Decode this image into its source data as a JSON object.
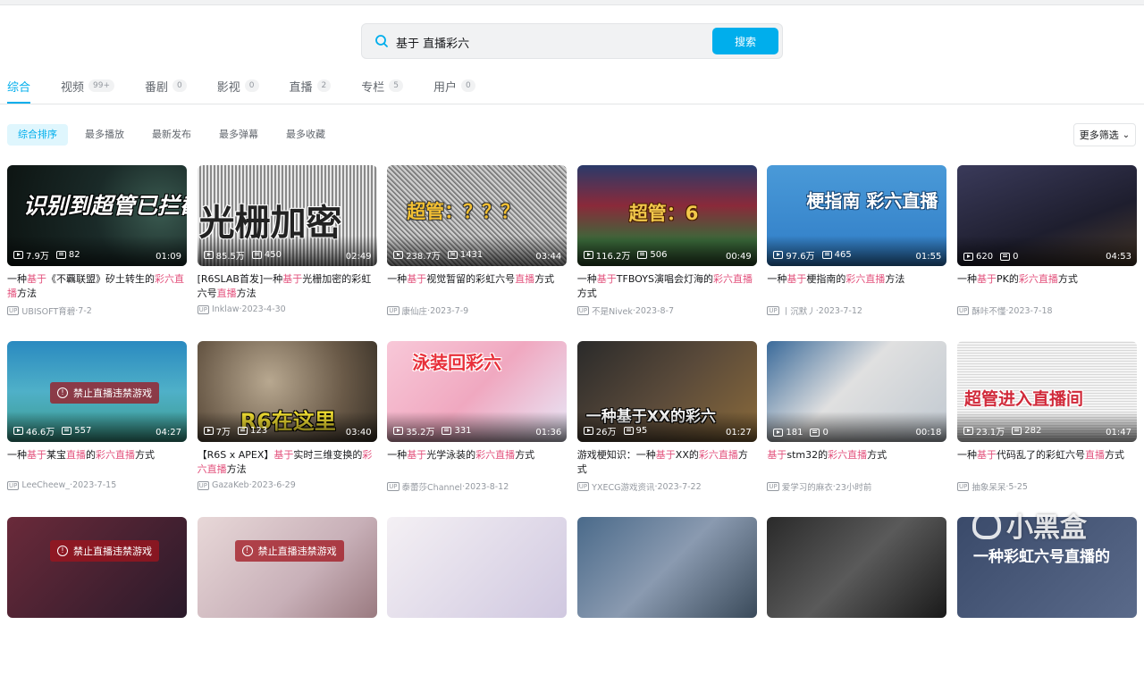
{
  "search": {
    "query": "基于 直播彩六",
    "button": "搜索"
  },
  "tabs": [
    {
      "label": "综合",
      "count": ""
    },
    {
      "label": "视频",
      "count": "99+"
    },
    {
      "label": "番剧",
      "count": "0"
    },
    {
      "label": "影视",
      "count": "0"
    },
    {
      "label": "直播",
      "count": "2"
    },
    {
      "label": "专栏",
      "count": "5"
    },
    {
      "label": "用户",
      "count": "0"
    }
  ],
  "sort": [
    "综合排序",
    "最多播放",
    "最新发布",
    "最多弹幕",
    "最多收藏"
  ],
  "filter_label": "更多筛选",
  "up_tag": "UP",
  "videos": [
    {
      "overlay": "识别到超管已拦截",
      "views": "7.9万",
      "danmaku": "82",
      "duration": "01:09",
      "title_parts": [
        "一种",
        "基于",
        "《不覊联盟》矽土转生的",
        "彩六直播",
        "方法"
      ],
      "author": "UBISOFT育碧",
      "date": "7-2"
    },
    {
      "overlay": "光栅加密",
      "views": "85.5万",
      "danmaku": "450",
      "duration": "02:49",
      "title_parts": [
        "[R6SLAB首发]一种",
        "基于",
        "光栅加密的彩虹六号",
        "直播",
        "方法"
      ],
      "author": "Inklaw",
      "date": "2023-4-30"
    },
    {
      "overlay": "超管：？？？",
      "views": "238.7万",
      "danmaku": "1431",
      "duration": "03:44",
      "title_parts": [
        "一种",
        "基于",
        "视觉暂留的彩虹六号",
        "直播",
        "方式"
      ],
      "author": "康仙庄",
      "date": "2023-7-9"
    },
    {
      "overlay": "超管：6",
      "views": "116.2万",
      "danmaku": "506",
      "duration": "00:49",
      "title_parts": [
        "一种",
        "基于",
        "TFBOYS演唱会灯海的",
        "彩六直播",
        "方式"
      ],
      "author": "不是Nivek",
      "date": "2023-8-7"
    },
    {
      "overlay": "梗指南 彩六直播",
      "views": "97.6万",
      "danmaku": "465",
      "duration": "01:55",
      "title_parts": [
        "一种",
        "基于",
        "梗指南的",
        "彩六直播",
        "方法"
      ],
      "author": "丨沉默丿",
      "date": "2023-7-12"
    },
    {
      "overlay": "",
      "views": "620",
      "danmaku": "0",
      "duration": "04:53",
      "title_parts": [
        "一种",
        "基于",
        "PK的",
        "彩六直播",
        "方式"
      ],
      "author": "酥咔不懂",
      "date": "2023-7-18"
    },
    {
      "overlay": "禁止直播违禁游戏",
      "views": "46.6万",
      "danmaku": "557",
      "duration": "04:27",
      "title_parts": [
        "一种",
        "基于",
        "某宝",
        "直播",
        "的",
        "彩六直播",
        "方式"
      ],
      "author": "LeeCheew_",
      "date": "2023-7-15"
    },
    {
      "overlay": "R6在这里",
      "views": "7万",
      "danmaku": "123",
      "duration": "03:40",
      "title_parts": [
        "【R6S x APEX】",
        "基于",
        "实时三维变换的",
        "彩六直播",
        "方法"
      ],
      "author": "GazaKeb",
      "date": "2023-6-29"
    },
    {
      "overlay": "泳装回彩六",
      "views": "35.2万",
      "danmaku": "331",
      "duration": "01:36",
      "title_parts": [
        "一种",
        "基于",
        "光学泳装的",
        "彩六直播",
        "方式"
      ],
      "author": "泰蕾莎Channel",
      "date": "2023-8-12"
    },
    {
      "overlay": "一种基于XX的彩六",
      "views": "26万",
      "danmaku": "95",
      "duration": "01:27",
      "title_parts": [
        "游戏梗知识：一种",
        "基于",
        "XX的",
        "彩六直播",
        "方式"
      ],
      "author": "YXECG游戏资讯",
      "date": "2023-7-22"
    },
    {
      "overlay": "",
      "views": "181",
      "danmaku": "0",
      "duration": "00:18",
      "title_parts": [
        "",
        "基于",
        "stm32的",
        "彩六直播",
        "方式"
      ],
      "author": "爱学习的麻衣",
      "date": "23小时前"
    },
    {
      "overlay": "超管进入直播间",
      "views": "23.1万",
      "danmaku": "282",
      "duration": "01:47",
      "title_parts": [
        "一种",
        "基于",
        "代码乱了的彩虹六号",
        "直播",
        "方式"
      ],
      "author": "抽象呆呆",
      "date": "5-25"
    }
  ],
  "row3_overlays": [
    "禁止直播违禁游戏",
    "禁止直播违禁游戏",
    "",
    "",
    "",
    "一种彩虹六号直播的"
  ],
  "watermark": "小黑盒",
  "colors": {
    "accent": "#00aeec",
    "highlight": "#e3537e",
    "muted": "#9499a0"
  }
}
